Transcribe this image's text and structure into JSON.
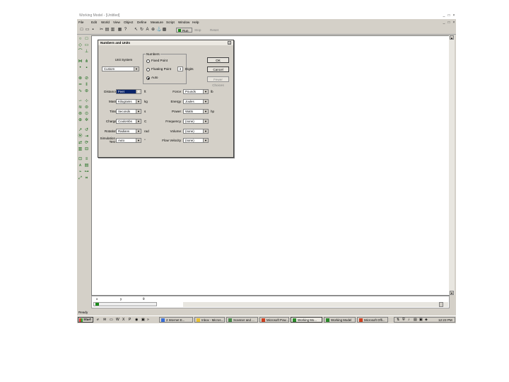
{
  "window": {
    "title": "Working Model - [Untitled]",
    "controls": [
      "_",
      "□",
      "×"
    ],
    "doc_controls": [
      "_",
      "□",
      "×"
    ]
  },
  "menubar": [
    "File",
    "Edit",
    "World",
    "View",
    "Object",
    "Define",
    "Measure",
    "Script",
    "Window",
    "Help"
  ],
  "toolbar": {
    "run_label": "Run",
    "stop_label": "Stop",
    "reset_label": "Reset"
  },
  "dialog": {
    "title": "Numbers and Units",
    "unit_system_label": "Unit System",
    "unit_system_value": "Custom",
    "numbers_label": "Numbers",
    "fixed_point": "Fixed Point",
    "floating_point": "Floating Point",
    "auto": "Auto",
    "digits_value": "3",
    "digits_label": "Digits",
    "ok": "OK",
    "cancel": "Cancel",
    "more_choices": "Fewer Choices",
    "left_rows": [
      {
        "label": "Distance",
        "value": "Feet",
        "unit": "ft"
      },
      {
        "label": "Mass",
        "value": "Kilograms",
        "unit": "kg"
      },
      {
        "label": "Time",
        "value": "Seconds",
        "unit": "s"
      },
      {
        "label": "Charge",
        "value": "Coulombs",
        "unit": "C"
      },
      {
        "label": "Rotation",
        "value": "Radians",
        "unit": "rad"
      },
      {
        "label": "Simulation Test",
        "value": "Auto",
        "unit": "°"
      }
    ],
    "right_rows": [
      {
        "label": "Force",
        "value": "Pounds",
        "unit": "lb"
      },
      {
        "label": "Energy",
        "value": "Joules",
        "unit": ""
      },
      {
        "label": "Power",
        "value": "Watts",
        "unit": "hp"
      },
      {
        "label": "Frequency",
        "value": "(none)",
        "unit": ""
      },
      {
        "label": "Volume",
        "value": "(none)",
        "unit": ""
      },
      {
        "label": "Flow Velocity",
        "value": "(none)",
        "unit": ""
      }
    ]
  },
  "status": {
    "text": "Ready"
  },
  "taskbar": {
    "start": "Start",
    "tasks": [
      "2 Internet E...",
      "Inbox - Micros...",
      "Scanner and ...",
      "Microsoft Pow...",
      "Working Mo...",
      "Working Model",
      "Microsoft Offi..."
    ],
    "clock": "12:23 PM"
  },
  "colors": {
    "chrome": "#d4d0c8",
    "canvas": "#ffffff",
    "selection": "#0a246a"
  }
}
